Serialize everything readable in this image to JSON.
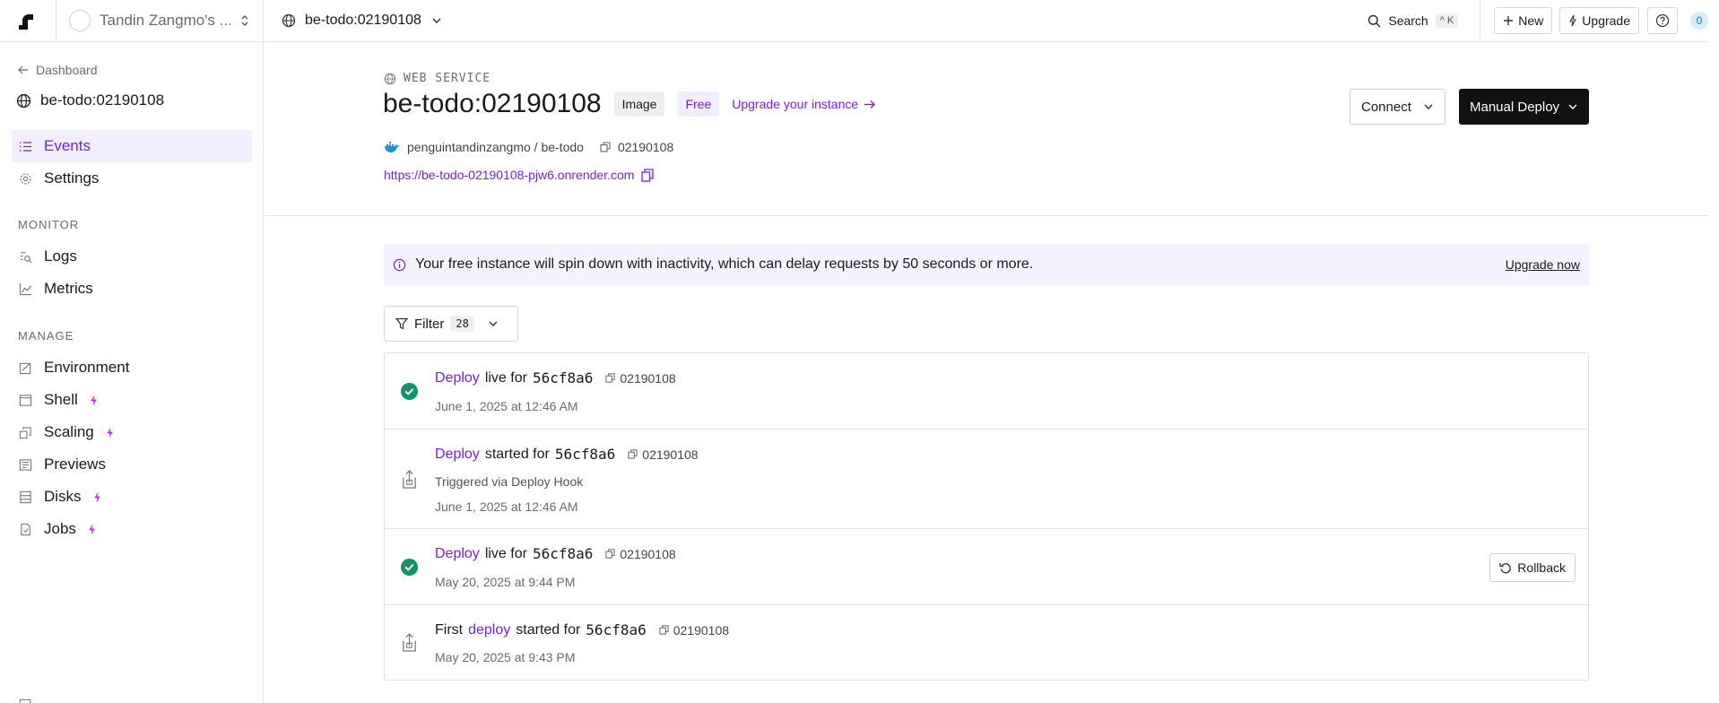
{
  "topbar": {
    "workspace_name": "Tandin Zangmo's ...",
    "service_name": "be-todo:02190108",
    "search_label": "Search",
    "search_shortcut": "^ K",
    "new_label": "New",
    "upgrade_label": "Upgrade",
    "notification_count": "0"
  },
  "sidebar": {
    "back_label": "Dashboard",
    "service_title": "be-todo:02190108",
    "primary": [
      {
        "label": "Events",
        "icon": "list-icon",
        "active": true
      },
      {
        "label": "Settings",
        "icon": "gear-icon",
        "active": false
      }
    ],
    "monitor_heading": "MONITOR",
    "monitor": [
      {
        "label": "Logs",
        "icon": "logs-search-icon"
      },
      {
        "label": "Metrics",
        "icon": "chart-icon"
      }
    ],
    "manage_heading": "MANAGE",
    "manage": [
      {
        "label": "Environment",
        "icon": "environment-icon",
        "pro": false
      },
      {
        "label": "Shell",
        "icon": "shell-icon",
        "pro": true
      },
      {
        "label": "Scaling",
        "icon": "scaling-icon",
        "pro": true
      },
      {
        "label": "Previews",
        "icon": "previews-icon",
        "pro": false
      },
      {
        "label": "Disks",
        "icon": "disk-icon",
        "pro": true
      },
      {
        "label": "Jobs",
        "icon": "jobs-icon",
        "pro": true
      }
    ]
  },
  "header": {
    "service_type": "WEB SERVICE",
    "title": "be-todo:02190108",
    "badge_image": "Image",
    "badge_plan": "Free",
    "upgrade_link": "Upgrade your instance",
    "repo": "penguintandinzangmo / be-todo",
    "commit_id": "02190108",
    "url": "https://be-todo-02190108-pjw6.onrender.com",
    "connect_label": "Connect",
    "deploy_label": "Manual Deploy"
  },
  "banner": {
    "text": "Your free instance will spin down with inactivity, which can delay requests by 50 seconds or more.",
    "action": "Upgrade now"
  },
  "filter": {
    "label": "Filter",
    "count": "28"
  },
  "events": [
    {
      "prefix": "",
      "link": "Deploy",
      "verb": "live for",
      "sha": "56cf8a6",
      "id": "02190108",
      "sub": "",
      "date": "June 1, 2025 at 12:46 AM",
      "status": "success"
    },
    {
      "prefix": "",
      "link": "Deploy",
      "verb": "started for",
      "sha": "56cf8a6",
      "id": "02190108",
      "sub": "Triggered via Deploy Hook",
      "date": "June 1, 2025 at 12:46 AM",
      "status": "started"
    },
    {
      "prefix": "",
      "link": "Deploy",
      "verb": "live for",
      "sha": "56cf8a6",
      "id": "02190108",
      "sub": "",
      "date": "May 20, 2025 at 9:44 PM",
      "status": "success",
      "action": "Rollback"
    },
    {
      "prefix": "First",
      "link": "deploy",
      "verb": "started for",
      "sha": "56cf8a6",
      "id": "02190108",
      "sub": "",
      "date": "May 20, 2025 at 9:43 PM",
      "status": "started"
    }
  ],
  "colors": {
    "accent": "#7a1fd8",
    "success": "#14936b",
    "bolt": "#c51cf0"
  }
}
